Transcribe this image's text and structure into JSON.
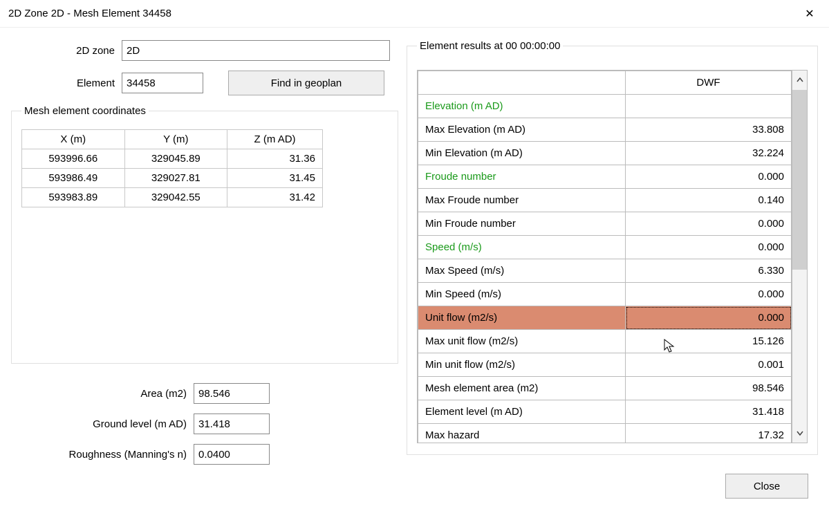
{
  "title": "2D Zone 2D - Mesh Element 34458",
  "form": {
    "zone_label": "2D zone",
    "zone_value": "2D",
    "element_label": "Element",
    "element_value": "34458",
    "find_button": "Find in geoplan"
  },
  "coord_section": {
    "legend": "Mesh element coordinates",
    "headers": {
      "x": "X (m)",
      "y": "Y (m)",
      "z": "Z (m AD)"
    },
    "rows": [
      {
        "x": "593996.66",
        "y": "329045.89",
        "z": "31.36"
      },
      {
        "x": "593986.49",
        "y": "329027.81",
        "z": "31.45"
      },
      {
        "x": "593983.89",
        "y": "329042.55",
        "z": "31.42"
      }
    ]
  },
  "lower": {
    "area_label": "Area (m2)",
    "area_value": "98.546",
    "ground_label": "Ground level (m AD)",
    "ground_value": "31.418",
    "rough_label": "Roughness (Manning's n)",
    "rough_value": "0.0400"
  },
  "results": {
    "legend": "Element results at 00 00:00:00",
    "col_header": "DWF",
    "rows": [
      {
        "label": "Elevation (m AD)",
        "value": "",
        "cls": "green"
      },
      {
        "label": "Max Elevation (m AD)",
        "value": "33.808",
        "cls": ""
      },
      {
        "label": "Min Elevation (m AD)",
        "value": "32.224",
        "cls": ""
      },
      {
        "label": "Froude number",
        "value": "0.000",
        "cls": "green"
      },
      {
        "label": "Max Froude number",
        "value": "0.140",
        "cls": ""
      },
      {
        "label": "Min Froude number",
        "value": "0.000",
        "cls": ""
      },
      {
        "label": "Speed (m/s)",
        "value": "0.000",
        "cls": "green"
      },
      {
        "label": "Max Speed (m/s)",
        "value": "6.330",
        "cls": ""
      },
      {
        "label": "Min Speed (m/s)",
        "value": "0.000",
        "cls": ""
      },
      {
        "label": "Unit flow (m2/s)",
        "value": "0.000",
        "cls": "",
        "selected": true
      },
      {
        "label": "Max unit flow (m2/s)",
        "value": "15.126",
        "cls": ""
      },
      {
        "label": "Min unit flow (m2/s)",
        "value": "0.001",
        "cls": ""
      },
      {
        "label": "Mesh element area (m2)",
        "value": "98.546",
        "cls": ""
      },
      {
        "label": "Element level (m AD)",
        "value": "31.418",
        "cls": ""
      },
      {
        "label": "Max hazard",
        "value": "17.32",
        "cls": ""
      }
    ]
  },
  "close_button": "Close"
}
